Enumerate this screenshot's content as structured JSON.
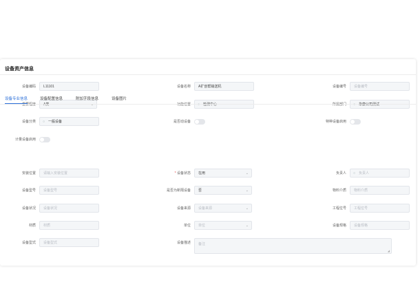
{
  "title": "设备资产信息",
  "basic": {
    "code_label": "设备编码",
    "code_value": "L11101",
    "name_label": "设备名称",
    "name_value": "A扩创帮输送机",
    "number_label": "设备编号",
    "number_placeholder": "设备编号",
    "importance_label": "重要程度",
    "importance_value": "A类",
    "location_label": "功能位置",
    "location_value": "检测中心",
    "dept_label": "所属部门",
    "dept_value": "华康公司测试",
    "category_label": "设备分类",
    "category_value": "一般设备",
    "mobile_label": "是否动设备",
    "special_label": "特种设备启用",
    "metering_label": "计量设备启用"
  },
  "tabs": [
    {
      "label": "设备专业信息",
      "active": true
    },
    {
      "label": "设备配置信息",
      "active": false
    },
    {
      "label": "附加字段信息",
      "active": false
    },
    {
      "label": "设备图片",
      "active": false
    }
  ],
  "detail": {
    "install_label": "安装位置",
    "install_placeholder": "请输入安装位置",
    "status_label": "设备状态",
    "status_required": "*",
    "status_value": "在用",
    "owner_label": "负责人",
    "owner_placeholder": "负责人",
    "model_label": "设备型号",
    "model_placeholder": "设备型号",
    "fire_label": "是否为新隔设备",
    "fire_value": "否",
    "material_label": "物料介质",
    "material_placeholder": "物料介质",
    "condition_label": "设备状况",
    "condition_placeholder": "设备状况",
    "source_label": "设备来源",
    "source_placeholder": "设备来源",
    "process_label": "工程位号",
    "process_placeholder": "工程位号",
    "texture_label": "材质",
    "texture_placeholder": "材质",
    "unit_label": "单位",
    "unit_placeholder": "单位",
    "spec_label": "设备规格",
    "spec_placeholder": "设备规格",
    "type_label": "设备型式",
    "type_placeholder": "设备型式",
    "desc_label": "设备描述",
    "desc_placeholder": "备注"
  }
}
